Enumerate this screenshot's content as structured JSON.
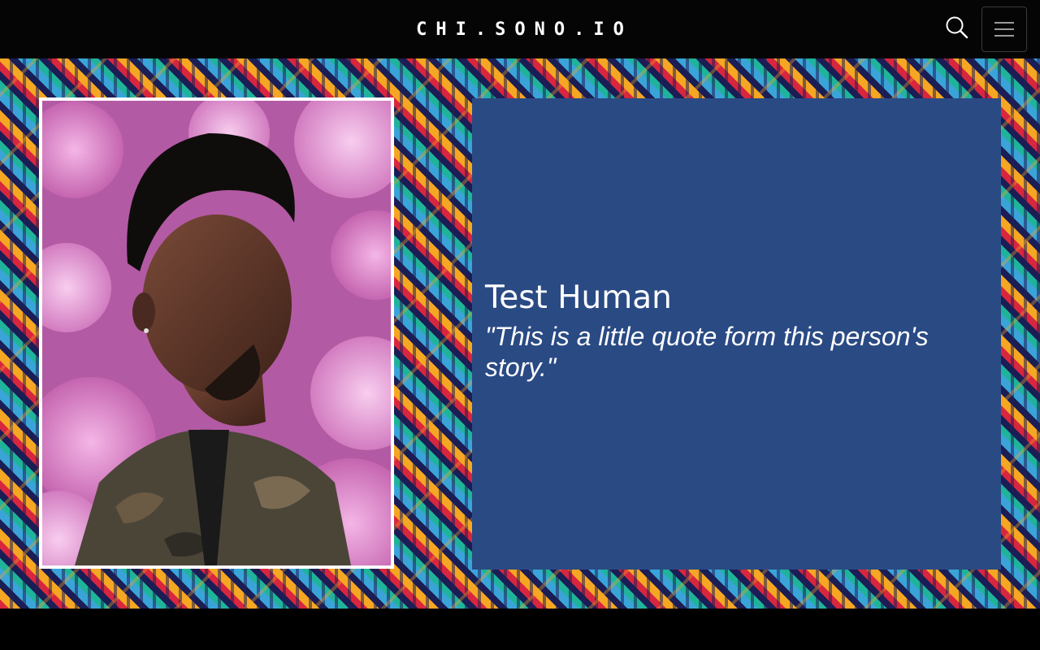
{
  "navbar": {
    "brand": "CHI.SONO.IO",
    "search_icon": "search-icon",
    "menu_icon": "hamburger-menu-icon"
  },
  "colors": {
    "navbar_bg": "#050505",
    "card_bg": "#2a4a84",
    "pattern_red": "#d8263e",
    "pattern_orange": "#f5a623",
    "pattern_navy": "#1b1d55",
    "pattern_blue": "#3aa4d8",
    "pattern_teal": "#1fb39a"
  },
  "story": {
    "name": "Test Human",
    "quote": "\"This is a little quote form this person's story.\""
  }
}
